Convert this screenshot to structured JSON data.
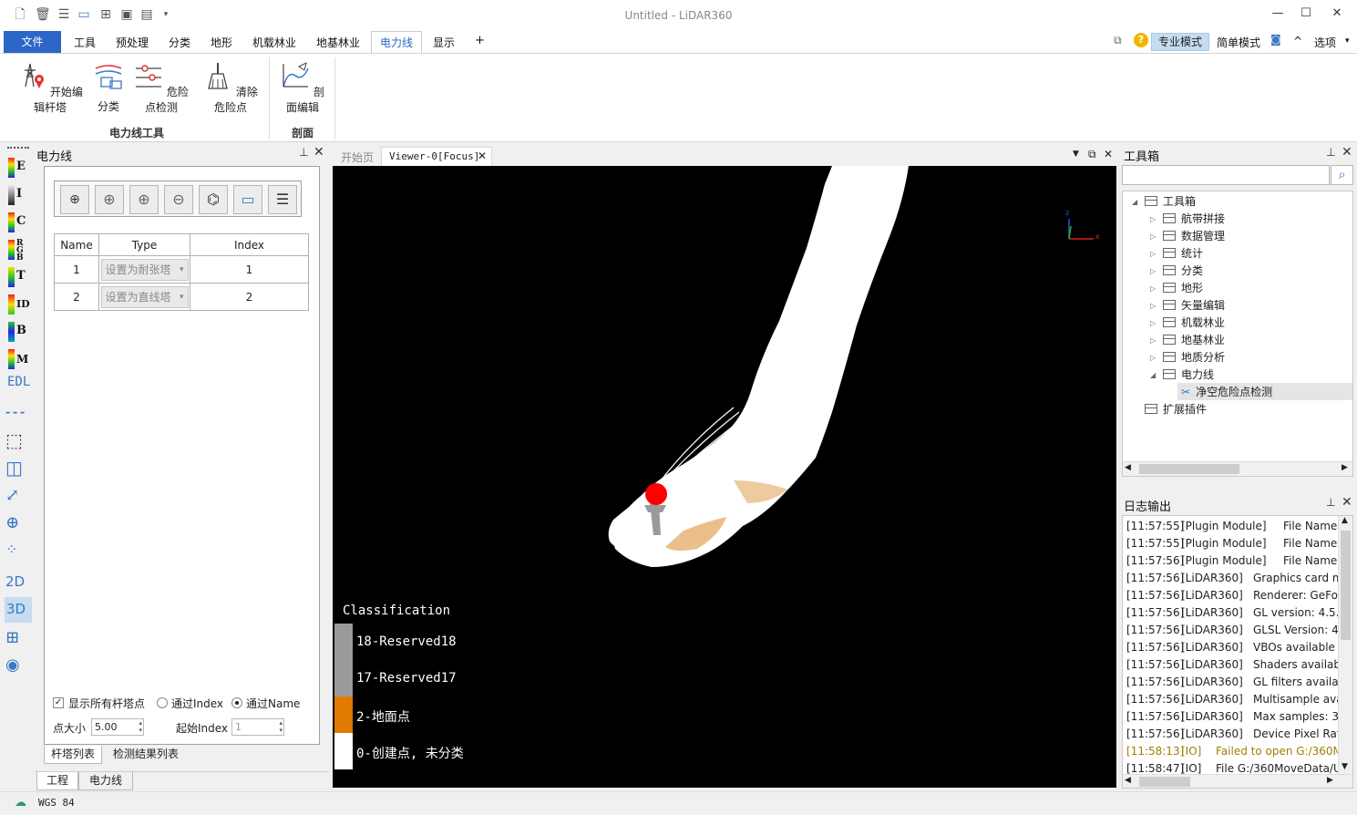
{
  "window": {
    "title": "Untitled - LiDAR360",
    "controls": [
      "minimize-icon",
      "maximize-icon",
      "close-icon"
    ]
  },
  "quick_access_icons": [
    "new-file-icon",
    "delete-icon",
    "document-icon",
    "open-folder-icon",
    "add-icon",
    "save-icon",
    "save-as-icon",
    "customize-icon"
  ],
  "menu": {
    "file": "文件",
    "tabs": [
      "工具",
      "预处理",
      "分类",
      "地形",
      "机载林业",
      "地基林业",
      "电力线",
      "显示"
    ],
    "active_tab": "电力线",
    "add": "+",
    "right": {
      "pro_mode": "专业模式",
      "simple_mode": "简单模式",
      "options": "选项",
      "collapse": "^"
    }
  },
  "ribbon": {
    "groups": [
      {
        "label": "电力线工具",
        "buttons": [
          "开始编辑杆塔",
          "分类",
          "危险点检测",
          "清除危险点"
        ]
      },
      {
        "label": "剖面",
        "buttons": [
          "剖面编辑"
        ]
      }
    ]
  },
  "left_strip": {
    "items": [
      "E",
      "I",
      "C",
      "RGB",
      "T",
      "ID",
      "B",
      "M",
      "EDL"
    ],
    "lower": [
      "2D",
      "3D"
    ]
  },
  "powerline_panel": {
    "title": "电力线",
    "table": {
      "headers": [
        "Name",
        "Type",
        "Index"
      ],
      "rows": [
        {
          "name": "1",
          "type": "设置为耐张塔",
          "index": "1"
        },
        {
          "name": "2",
          "type": "设置为直线塔",
          "index": "2"
        }
      ]
    },
    "options": {
      "show_all": "显示所有杆塔点",
      "by_index": "通过Index",
      "by_name": "通过Name",
      "point_size_label": "点大小",
      "point_size": "5.00",
      "start_index_label": "起始Index",
      "start_index": "1"
    },
    "tabs": [
      "杆塔列表",
      "检测结果列表"
    ],
    "bottom_tabs": [
      "工程",
      "电力线"
    ]
  },
  "viewer": {
    "tabs": [
      "开始页",
      "Viewer-0[Focus]"
    ],
    "legend_title": "Classification",
    "legend": [
      {
        "label": "18-Reserved18",
        "color": "#9a9a9a"
      },
      {
        "label": "17-Reserved17",
        "color": "#9a9a9a"
      },
      {
        "label": "2-地面点",
        "color": "#e07a00"
      },
      {
        "label": "0-创建点, 未分类",
        "color": "#ffffff"
      }
    ],
    "axis": {
      "x": "x",
      "y": "y",
      "z": "z"
    }
  },
  "toolbox": {
    "title": "工具箱",
    "search_placeholder": "",
    "root": "工具箱",
    "items": [
      "航带拼接",
      "数据管理",
      "统计",
      "分类",
      "地形",
      "矢量编辑",
      "机载林业",
      "地基林业",
      "地质分析",
      "电力线"
    ],
    "sub_item": "净空危险点检测",
    "extension": "扩展插件"
  },
  "log": {
    "title": "日志输出",
    "lines": [
      {
        "time": "[11:57:55]",
        "src": "[Plugin Module]",
        "msg": "File Name:",
        "warn": false
      },
      {
        "time": "[11:57:55]",
        "src": "[Plugin Module]",
        "msg": "File Name:",
        "warn": false
      },
      {
        "time": "[11:57:56]",
        "src": "[Plugin Module]",
        "msg": "File Name:",
        "warn": false
      },
      {
        "time": "[11:57:56]",
        "src": "[LiDAR360]",
        "msg": "Graphics card m",
        "warn": false
      },
      {
        "time": "[11:57:56]",
        "src": "[LiDAR360]",
        "msg": "Renderer: GeFo",
        "warn": false
      },
      {
        "time": "[11:57:56]",
        "src": "[LiDAR360]",
        "msg": "GL version: 4.5.0",
        "warn": false
      },
      {
        "time": "[11:57:56]",
        "src": "[LiDAR360]",
        "msg": "GLSL Version: 4.",
        "warn": false
      },
      {
        "time": "[11:57:56]",
        "src": "[LiDAR360]",
        "msg": "VBOs available",
        "warn": false
      },
      {
        "time": "[11:57:56]",
        "src": "[LiDAR360]",
        "msg": "Shaders availab",
        "warn": false
      },
      {
        "time": "[11:57:56]",
        "src": "[LiDAR360]",
        "msg": "GL filters availal",
        "warn": false
      },
      {
        "time": "[11:57:56]",
        "src": "[LiDAR360]",
        "msg": "Multisample ava",
        "warn": false
      },
      {
        "time": "[11:57:56]",
        "src": "[LiDAR360]",
        "msg": "Max samples: 3",
        "warn": false
      },
      {
        "time": "[11:57:56]",
        "src": "[LiDAR360]",
        "msg": "Device Pixel Rati",
        "warn": false
      },
      {
        "time": "[11:58:13]",
        "src": "[IO]",
        "msg": "Failed to open G:/360M",
        "warn": true
      },
      {
        "time": "[11:58:47]",
        "src": "[IO]",
        "msg": "File G:/360MoveData/U",
        "warn": false
      }
    ]
  },
  "status": {
    "crs": "WGS 84"
  },
  "colors": {
    "accent": "#2c66c7",
    "danger_point": "#ff0000",
    "ground": "#e07a00",
    "warn_text": "#a08000"
  }
}
